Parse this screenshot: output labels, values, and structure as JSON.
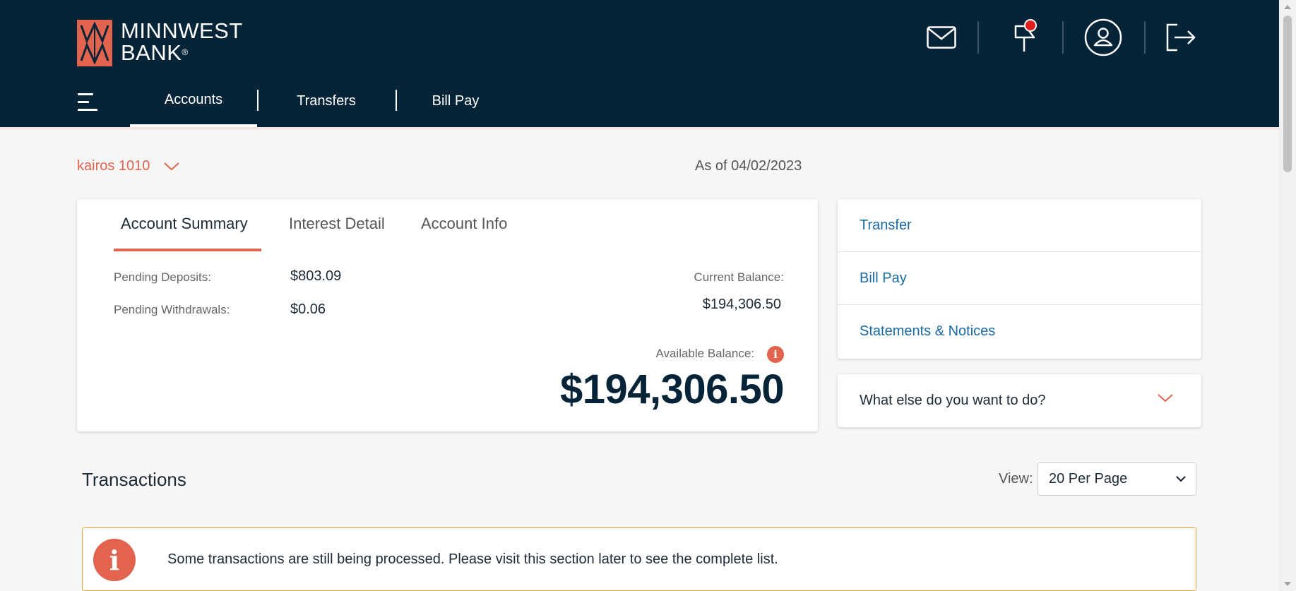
{
  "brand": {
    "name_line1": "MINNWEST",
    "name_line2": "BANK",
    "registered": "®"
  },
  "header_icons": [
    "mail-icon",
    "flag-icon",
    "user-icon",
    "logout-icon"
  ],
  "nav": {
    "tabs": [
      "Accounts",
      "Transfers",
      "Bill Pay"
    ],
    "active": "Accounts"
  },
  "account": {
    "selected": "kairos 1010",
    "as_of": "As of 04/02/2023"
  },
  "summary": {
    "tabs": [
      "Account Summary",
      "Interest Detail",
      "Account Info"
    ],
    "active_tab": "Account Summary",
    "pending_deposits_label": "Pending Deposits:",
    "pending_deposits_value": "$803.09",
    "pending_withdrawals_label": "Pending Withdrawals:",
    "pending_withdrawals_value": "$0.06",
    "current_balance_label": "Current Balance:",
    "current_balance_value": "$194,306.50",
    "available_balance_label": "Available Balance:",
    "available_balance_value": "$194,306.50",
    "info_glyph": "i"
  },
  "quick_links": [
    "Transfer",
    "Bill Pay",
    "Statements & Notices"
  ],
  "more_actions": "What else do you want to do?",
  "transactions": {
    "title": "Transactions",
    "view_label": "View:",
    "view_value": "20 Per Page",
    "notice": "Some transactions are still being processed. Please visit this section later to see the complete list.",
    "notice_glyph": "i"
  },
  "colors": {
    "header_bg": "#062438",
    "accent": "#e2634e",
    "link": "#1a6aa3",
    "notice_border": "#e6a43a"
  }
}
